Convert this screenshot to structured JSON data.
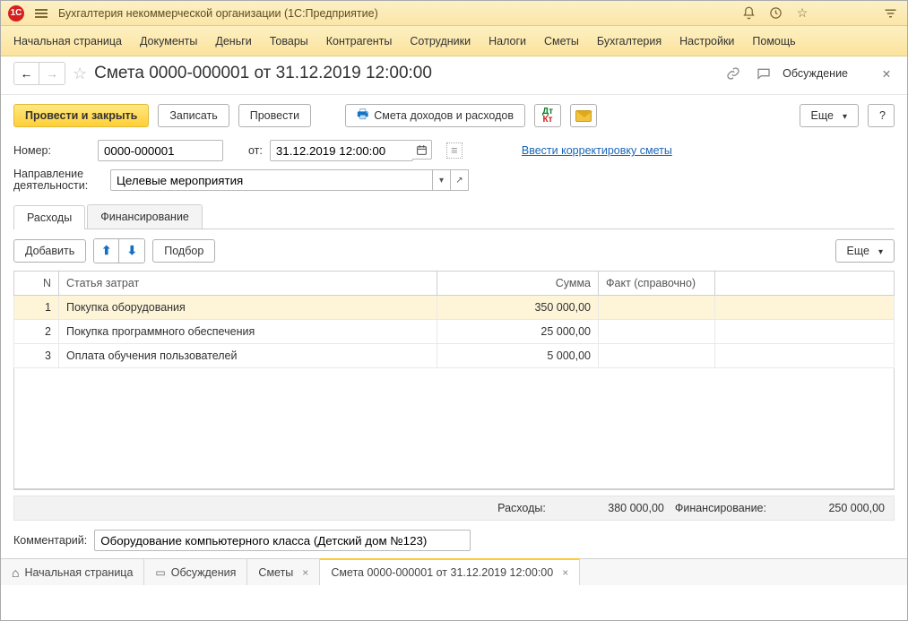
{
  "app": {
    "title": "Бухгалтерия некоммерческой организации  (1С:Предприятие)"
  },
  "main_menu": [
    "Начальная страница",
    "Документы",
    "Деньги",
    "Товары",
    "Контрагенты",
    "Сотрудники",
    "Налоги",
    "Сметы",
    "Бухгалтерия",
    "Настройки",
    "Помощь"
  ],
  "page": {
    "title": "Смета 0000-000001 от 31.12.2019 12:00:00",
    "discuss": "Обсуждение"
  },
  "toolbar": {
    "post_close": "Провести и закрыть",
    "save": "Записать",
    "post": "Провести",
    "print": "Смета доходов и расходов",
    "more": "Еще",
    "help": "?"
  },
  "form": {
    "number_label": "Номер:",
    "number_value": "0000-000001",
    "from_label": "от:",
    "date_value": "31.12.2019 12:00:00",
    "correction_link": "Ввести корректировку сметы",
    "direction_label": "Направление деятельности:",
    "direction_value": "Целевые мероприятия"
  },
  "tabs": {
    "expenses": "Расходы",
    "financing": "Финансирование"
  },
  "table_tools": {
    "add": "Добавить",
    "pick": "Подбор",
    "more": "Еще"
  },
  "columns": {
    "n": "N",
    "item": "Статья затрат",
    "sum": "Сумма",
    "fact": "Факт (справочно)"
  },
  "rows": [
    {
      "n": "1",
      "item": "Покупка оборудования",
      "sum": "350 000,00",
      "fact": ""
    },
    {
      "n": "2",
      "item": "Покупка программного обеспечения",
      "sum": "25 000,00",
      "fact": ""
    },
    {
      "n": "3",
      "item": "Оплата обучения пользователей",
      "sum": "5 000,00",
      "fact": ""
    }
  ],
  "totals": {
    "expenses_label": "Расходы:",
    "expenses_value": "380 000,00",
    "financing_label": "Финансирование:",
    "financing_value": "250 000,00"
  },
  "comment": {
    "label": "Комментарий:",
    "value": "Оборудование компьютерного класса (Детский дом №123)"
  },
  "window_tabs": {
    "home": "Начальная страница",
    "discussions": "Обсуждения",
    "estimates": "Сметы",
    "current": "Смета 0000-000001 от 31.12.2019 12:00:00"
  }
}
